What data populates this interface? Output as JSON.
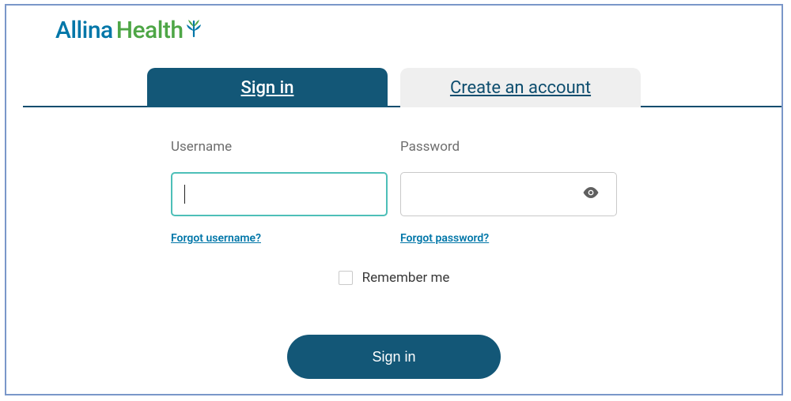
{
  "logo": {
    "part1": "Allina",
    "part2": "Health"
  },
  "tabs": {
    "signin": "Sign in",
    "create": "Create an account"
  },
  "form": {
    "username_label": "Username",
    "password_label": "Password",
    "forgot_username": "Forgot username?",
    "forgot_password": "Forgot password?",
    "remember_label": "Remember me",
    "submit_label": "Sign in"
  },
  "colors": {
    "brand_blue": "#0076a8",
    "brand_green": "#4ea646",
    "tab_active_bg": "#135777",
    "tab_inactive_bg": "#efefef",
    "border_focus": "#4dbfb8",
    "border_normal": "#c9c9c9",
    "frame_border": "#7a97c9"
  }
}
